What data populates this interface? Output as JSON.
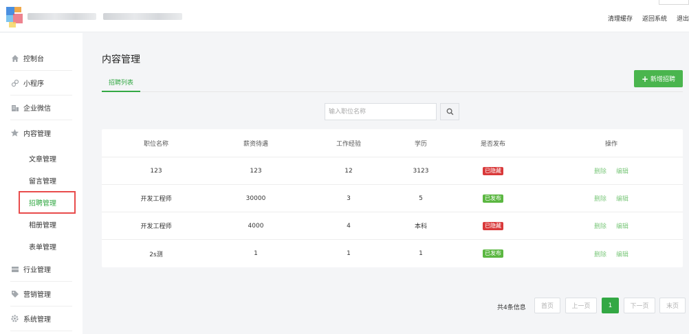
{
  "header": {
    "links": [
      "清理缓存",
      "返回系统",
      "退出"
    ]
  },
  "sidebar": {
    "items": [
      {
        "label": "控制台",
        "icon": "home-icon"
      },
      {
        "label": "小程序",
        "icon": "miniprogram-icon"
      },
      {
        "label": "企业微信",
        "icon": "building-icon"
      },
      {
        "label": "内容管理",
        "icon": "star-icon"
      },
      {
        "label": "行业管理",
        "icon": "stack-icon"
      },
      {
        "label": "营销管理",
        "icon": "tag-icon"
      },
      {
        "label": "系统管理",
        "icon": "gear-icon"
      }
    ],
    "sub_items": [
      "文章管理",
      "留言管理",
      "招聘管理",
      "相册管理",
      "表单管理"
    ]
  },
  "main": {
    "title": "内容管理",
    "tab": "招聘列表",
    "add_button": "新增招聘",
    "search_placeholder": "输入职位名称"
  },
  "table": {
    "headers": [
      "职位名称",
      "薪资待遇",
      "工作经验",
      "学历",
      "是否发布",
      "操作"
    ],
    "rows": [
      {
        "name": "123",
        "salary": "123",
        "exp": "12",
        "edu": "3123",
        "status": "已隐藏",
        "status_type": "hidden"
      },
      {
        "name": "开发工程师",
        "salary": "30000",
        "exp": "3",
        "edu": "5",
        "status": "已发布",
        "status_type": "pub"
      },
      {
        "name": "开发工程师",
        "salary": "4000",
        "exp": "4",
        "edu": "本科",
        "status": "已隐藏",
        "status_type": "hidden"
      },
      {
        "name": "2s测",
        "salary": "1",
        "exp": "1",
        "edu": "1",
        "status": "已发布",
        "status_type": "pub"
      }
    ],
    "ops": [
      "删除",
      "编辑"
    ]
  },
  "pagination": {
    "total": "共4条信息",
    "first": "首页",
    "prev": "上一页",
    "current": "1",
    "next": "下一页",
    "last": "末页"
  },
  "colors": {
    "accent": "#33a844",
    "hidden_badge": "#d9393a",
    "published_badge": "#5bb741",
    "highlight_box": "#e84b4b"
  }
}
